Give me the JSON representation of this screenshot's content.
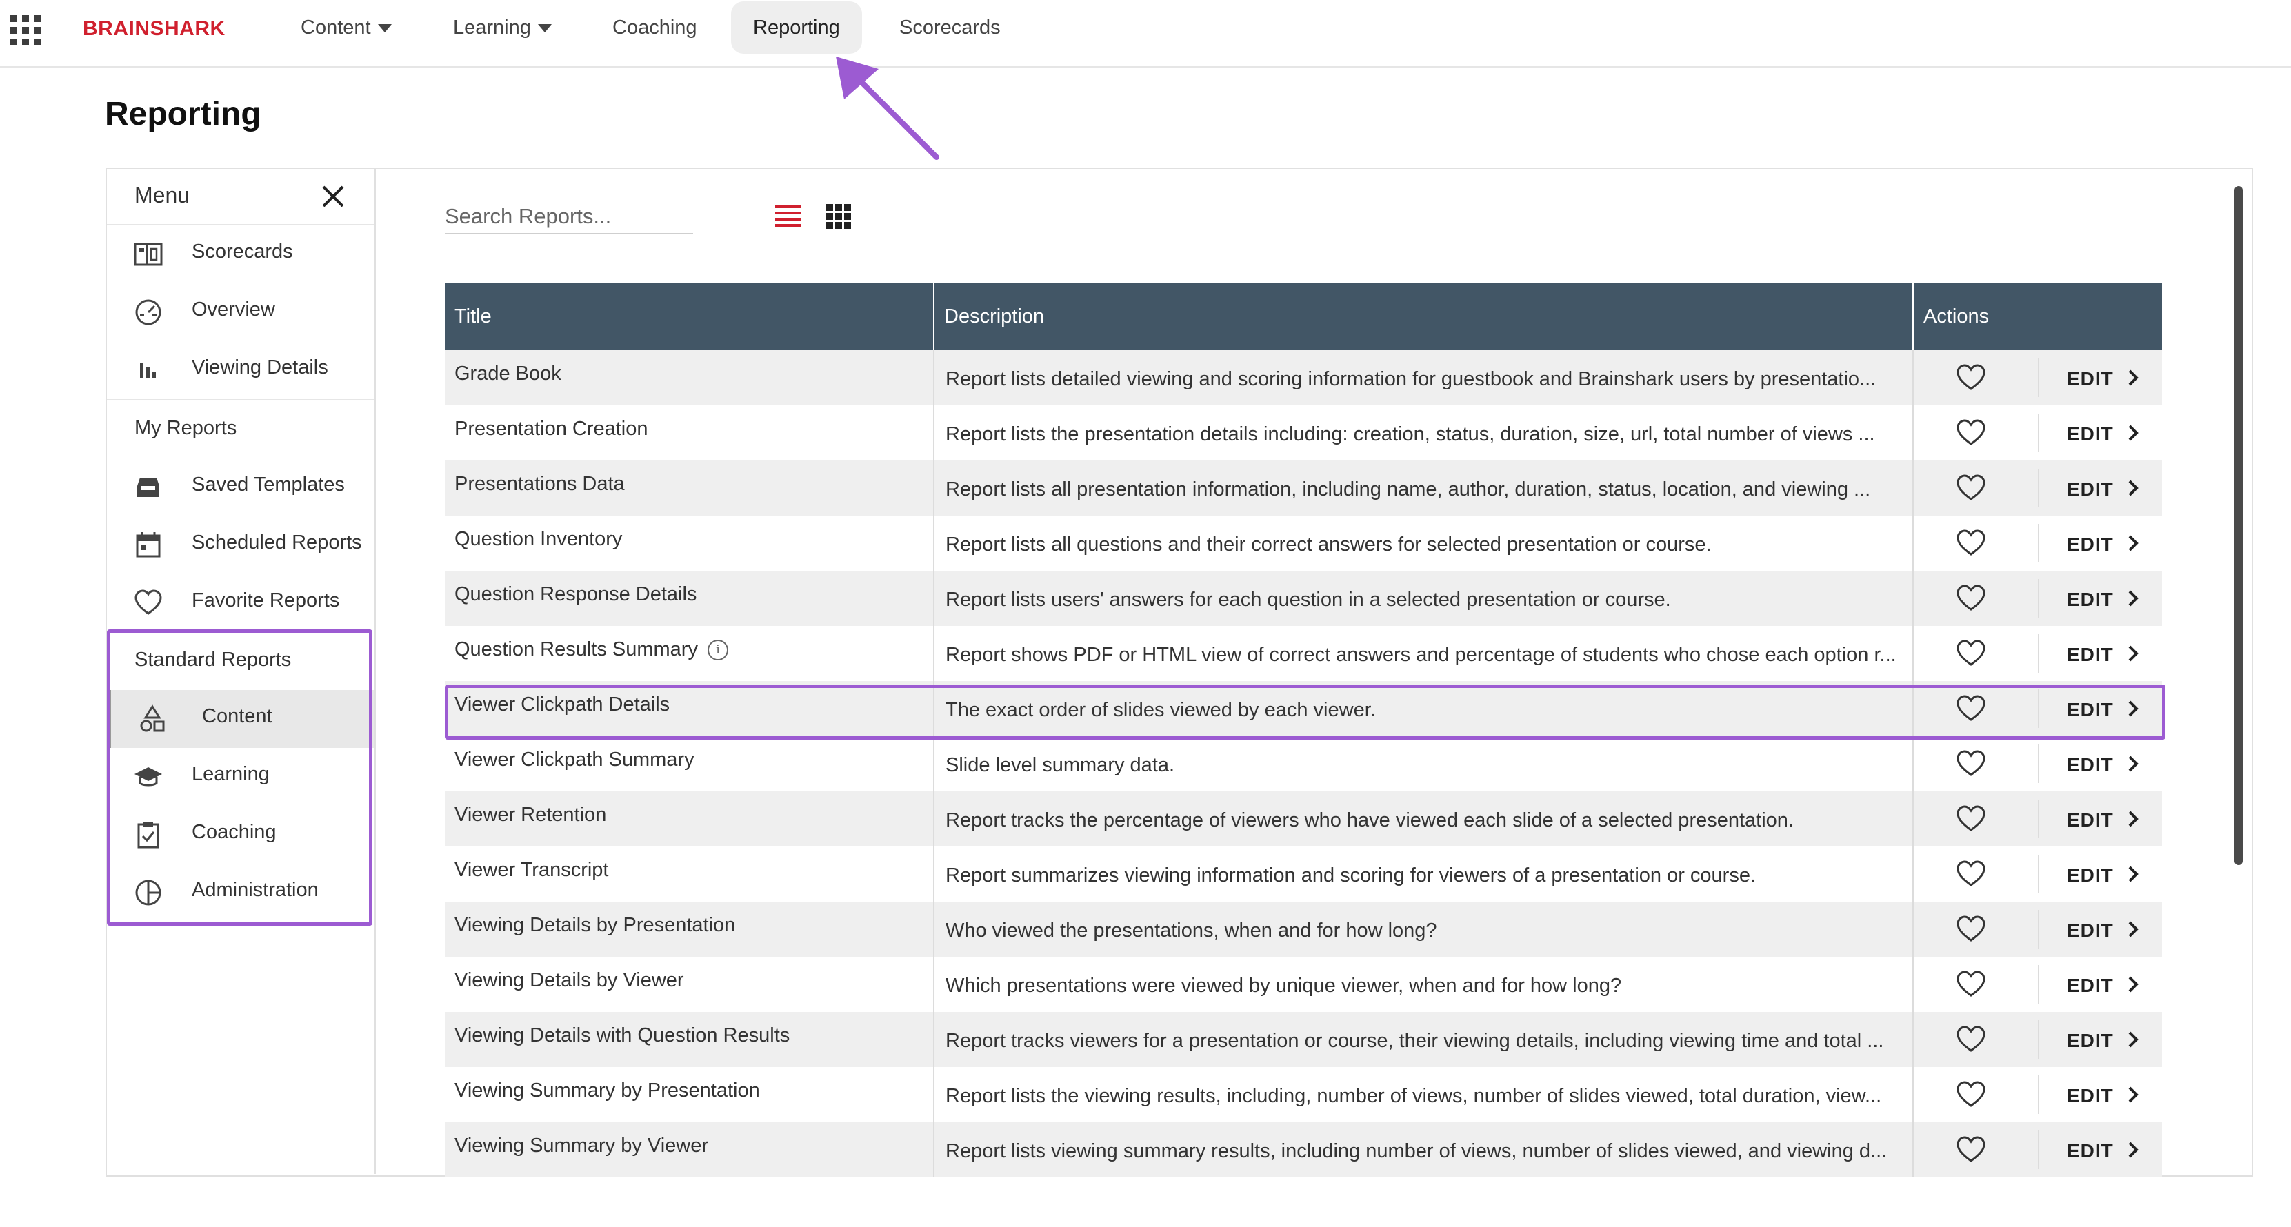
{
  "brand": "BRAINSHARK",
  "nav": {
    "items": [
      {
        "label": "Content",
        "dropdown": true
      },
      {
        "label": "Learning",
        "dropdown": true
      },
      {
        "label": "Coaching",
        "dropdown": false
      },
      {
        "label": "Reporting",
        "dropdown": false,
        "active": true
      },
      {
        "label": "Scorecards",
        "dropdown": false
      }
    ]
  },
  "page": {
    "title": "Reporting"
  },
  "menu": {
    "header": "Menu",
    "top_items": [
      {
        "label": "Scorecards",
        "icon": "scorecard-icon"
      },
      {
        "label": "Overview",
        "icon": "gauge-icon"
      },
      {
        "label": "Viewing Details",
        "icon": "bar-chart-icon"
      }
    ],
    "my_reports": {
      "heading": "My Reports",
      "items": [
        {
          "label": "Saved Templates",
          "icon": "tray-icon"
        },
        {
          "label": "Scheduled Reports",
          "icon": "calendar-icon"
        },
        {
          "label": "Favorite Reports",
          "icon": "heart-icon"
        }
      ]
    },
    "standard_reports": {
      "heading": "Standard Reports",
      "items": [
        {
          "label": "Content",
          "icon": "shapes-icon",
          "selected": true
        },
        {
          "label": "Learning",
          "icon": "graduation-cap-icon"
        },
        {
          "label": "Coaching",
          "icon": "clipboard-icon"
        },
        {
          "label": "Administration",
          "icon": "pie-icon"
        }
      ]
    }
  },
  "search": {
    "placeholder": "Search Reports..."
  },
  "table": {
    "columns": [
      "Title",
      "Description",
      "Actions"
    ],
    "edit_label": "EDIT",
    "rows": [
      {
        "title": "Grade Book",
        "description": "Report lists detailed viewing and scoring information for guestbook and Brainshark users by presentatio..."
      },
      {
        "title": "Presentation Creation",
        "description": "Report lists the presentation details including: creation, status, duration, size, url, total number of views ..."
      },
      {
        "title": "Presentations Data",
        "description": "Report lists all presentation information, including name, author, duration, status, location, and viewing ..."
      },
      {
        "title": "Question Inventory",
        "description": "Report lists all questions and their correct answers for selected presentation or course."
      },
      {
        "title": "Question Response Details",
        "description": "Report lists users' answers for each question in a selected presentation or course."
      },
      {
        "title": "Question Results Summary",
        "description": "Report shows PDF or HTML view of correct answers and percentage of students who chose each option r...",
        "info": "i"
      },
      {
        "title": "Viewer Clickpath Details",
        "description": "The exact order of slides viewed by each viewer."
      },
      {
        "title": "Viewer Clickpath Summary",
        "description": "Slide level summary data."
      },
      {
        "title": "Viewer Retention",
        "description": "Report tracks the percentage of viewers who have viewed each slide of a selected presentation."
      },
      {
        "title": "Viewer Transcript",
        "description": "Report summarizes viewing information and scoring for viewers of a presentation or course."
      },
      {
        "title": "Viewing Details by Presentation",
        "description": "Who viewed the presentations, when and for how long?"
      },
      {
        "title": "Viewing Details by Viewer",
        "description": "Which presentations were viewed by unique viewer, when and for how long?"
      },
      {
        "title": "Viewing Details with Question Results",
        "description": "Report tracks viewers for a presentation or course, their viewing details, including viewing time and total ..."
      },
      {
        "title": "Viewing Summary by Presentation",
        "description": "Report lists the viewing results, including, number of views, number of slides viewed, total duration, view..."
      },
      {
        "title": "Viewing Summary by Viewer",
        "description": "Report lists viewing summary results, including number of views, number of slides viewed, and viewing d..."
      }
    ]
  },
  "colors": {
    "brand": "#d0202e",
    "header": "#425666",
    "highlight": "#9c5bd2"
  }
}
